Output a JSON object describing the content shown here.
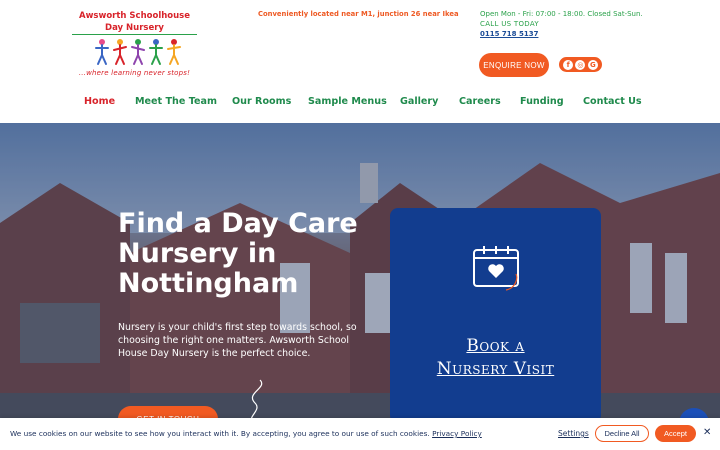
{
  "header": {
    "logo_title": "Awsworth Schoolhouse Day Nursery",
    "logo_tagline": "...where learning never stops!",
    "location": "Conveniently located near M1, junction 26 near Ikea",
    "hours": "Open Mon - Fri: 07:00 - 18:00. Closed Sat-Sun.",
    "call_label": "CALL US TODAY",
    "phone": "0115 718 5137",
    "enquire_label": "ENQUIRE NOW",
    "social_icons": [
      "facebook-icon",
      "instagram-icon",
      "google-icon"
    ]
  },
  "nav": {
    "items": [
      {
        "label": "Home",
        "active": true
      },
      {
        "label": "Meet The Team"
      },
      {
        "label": "Our Rooms"
      },
      {
        "label": "Sample Menus"
      },
      {
        "label": "Gallery"
      },
      {
        "label": "Careers"
      },
      {
        "label": "Funding"
      },
      {
        "label": "Contact Us"
      }
    ]
  },
  "hero": {
    "title": "Find a Day Care Nursery in Nottingham",
    "text": "Nursery is your child's first step towards school, so choosing the right one matters. Awsworth School House Day Nursery is the perfect choice.",
    "button_label": "GET IN TOUCH",
    "visit_card": {
      "line1": "Book a",
      "line2": "Nursery Visit"
    }
  },
  "cookie": {
    "text": "We use cookies on our website to see how you interact with it. By accepting, you agree to our use of such cookies.",
    "policy_link": "Privacy Policy",
    "settings": "Settings",
    "decline": "Decline All",
    "accept": "Accept",
    "close": "✕"
  },
  "colors": {
    "brand_orange": "#f15a22",
    "nav_green": "#1f8a4c",
    "active_red": "#d8232a",
    "card_blue": "#123d8f"
  }
}
